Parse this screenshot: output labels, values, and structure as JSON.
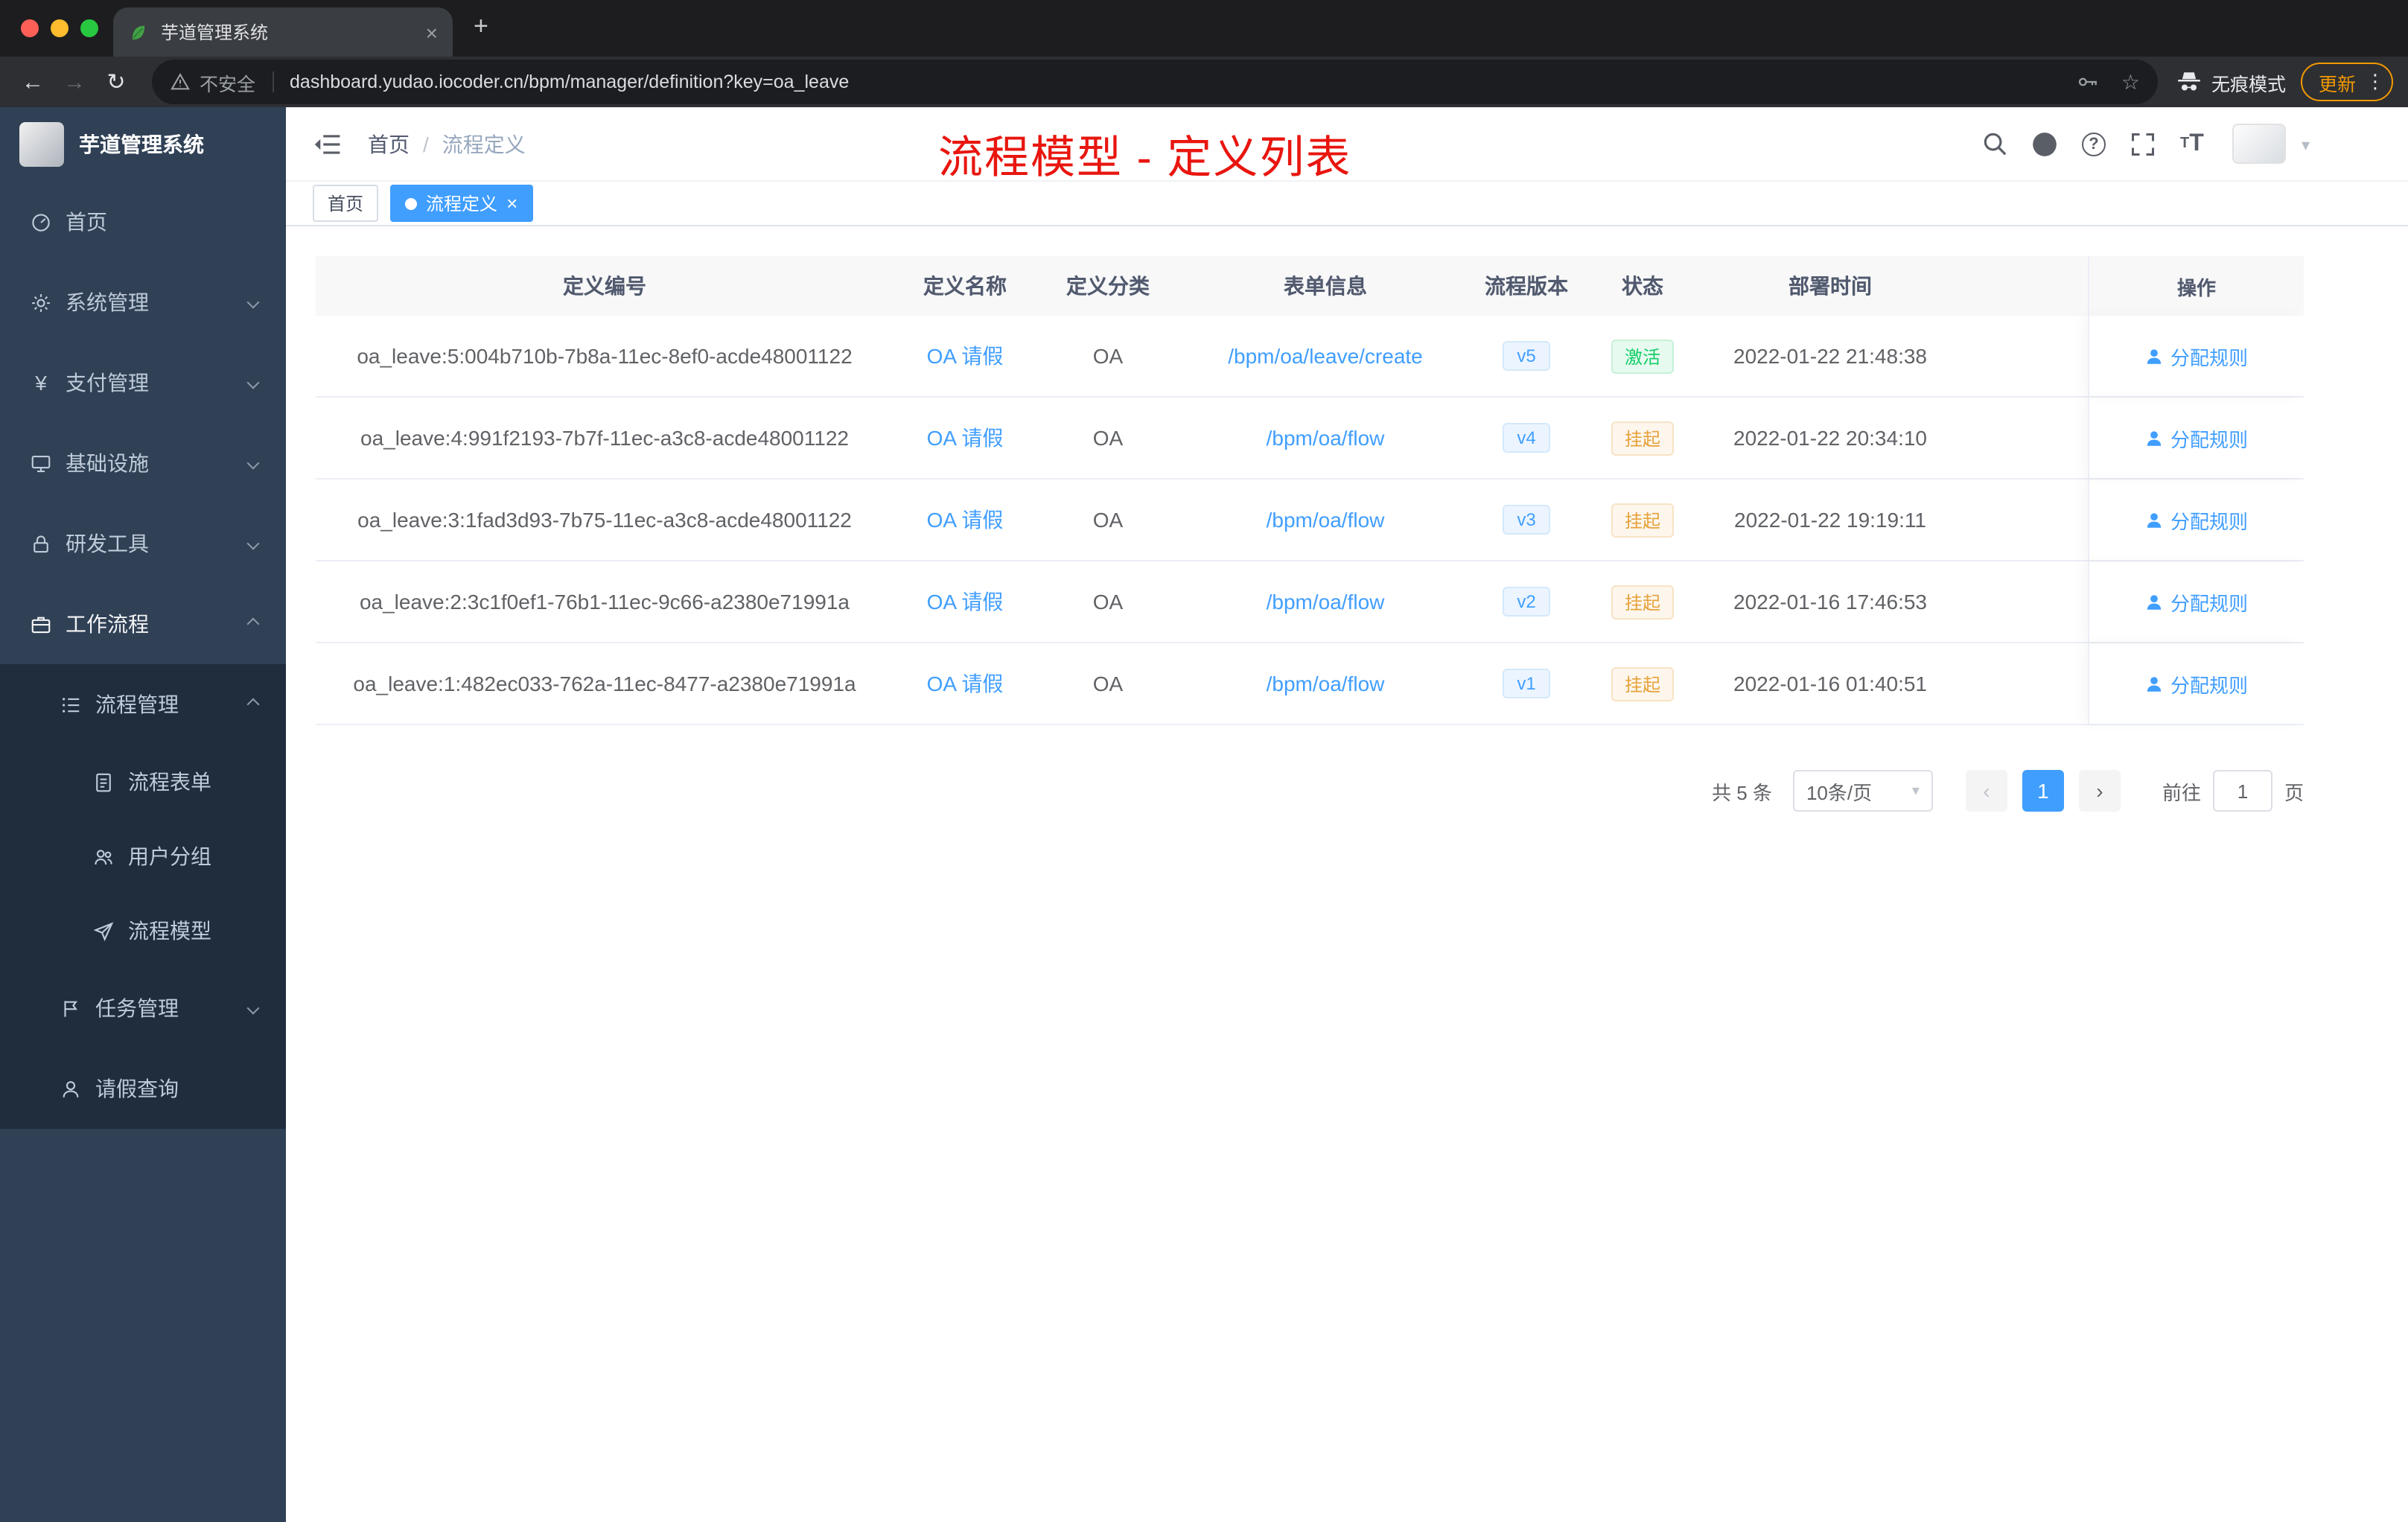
{
  "colors": {
    "accent": "#409eff",
    "success": "#13ce66",
    "warning": "#e6a23c",
    "annotation": "#e8160f",
    "sidebar": "#304156",
    "sidebarSub": "#1f2d3d"
  },
  "icons": {
    "back": "←",
    "forward": "→",
    "reload": "↻",
    "star": "☆",
    "kebab": "⋮",
    "plus": "+",
    "close": "×",
    "question": "?",
    "caret_down": "▾",
    "prev": "‹",
    "next": "›",
    "breadcrumb_sep": "/",
    "fontsize_big": "T",
    "fontsize_small": "T",
    "yen": "¥"
  },
  "browser": {
    "tab_title": "芋道管理系统",
    "security_label": "不安全",
    "url": "dashboard.yudao.iocoder.cn/bpm/manager/definition?key=oa_leave",
    "incognito_label": "无痕模式",
    "update_label": "更新"
  },
  "sidebar": {
    "title": "芋道管理系统",
    "items": [
      {
        "label": "首页",
        "icon": "dashboard-icon"
      },
      {
        "label": "系统管理",
        "icon": "gear-icon"
      },
      {
        "label": "支付管理",
        "icon": "yen-icon"
      },
      {
        "label": "基础设施",
        "icon": "infrastructure-icon"
      },
      {
        "label": "研发工具",
        "icon": "devtools-icon"
      },
      {
        "label": "工作流程",
        "icon": "workflow-icon"
      },
      {
        "label": "流程管理",
        "icon": "process-management-icon"
      },
      {
        "label": "流程表单",
        "icon": "form-icon"
      },
      {
        "label": "用户分组",
        "icon": "user-group-icon"
      },
      {
        "label": "流程模型",
        "icon": "paper-plane-icon"
      },
      {
        "label": "任务管理",
        "icon": "task-icon"
      },
      {
        "label": "请假查询",
        "icon": "user-icon"
      }
    ]
  },
  "header": {
    "breadcrumb_home": "首页",
    "breadcrumb_current": "流程定义",
    "annotation": "流程模型 - 定义列表"
  },
  "tags": {
    "home": "首页",
    "active": "流程定义"
  },
  "table": {
    "columns": [
      "定义编号",
      "定义名称",
      "定义分类",
      "表单信息",
      "流程版本",
      "状态",
      "部署时间",
      "操作"
    ],
    "rows": [
      {
        "id": "oa_leave:5:004b710b-7b8a-11ec-8ef0-acde48001122",
        "name": "OA 请假",
        "category": "OA",
        "form": "/bpm/oa/leave/create",
        "version": "v5",
        "status": "激活",
        "time": "2022-01-22 21:48:38",
        "action": "分配规则"
      },
      {
        "id": "oa_leave:4:991f2193-7b7f-11ec-a3c8-acde48001122",
        "name": "OA 请假",
        "category": "OA",
        "form": "/bpm/oa/flow",
        "version": "v4",
        "status": "挂起",
        "time": "2022-01-22 20:34:10",
        "action": "分配规则"
      },
      {
        "id": "oa_leave:3:1fad3d93-7b75-11ec-a3c8-acde48001122",
        "name": "OA 请假",
        "category": "OA",
        "form": "/bpm/oa/flow",
        "version": "v3",
        "status": "挂起",
        "time": "2022-01-22 19:19:11",
        "action": "分配规则"
      },
      {
        "id": "oa_leave:2:3c1f0ef1-76b1-11ec-9c66-a2380e71991a",
        "name": "OA 请假",
        "category": "OA",
        "form": "/bpm/oa/flow",
        "version": "v2",
        "status": "挂起",
        "time": "2022-01-16 17:46:53",
        "action": "分配规则"
      },
      {
        "id": "oa_leave:1:482ec033-762a-11ec-8477-a2380e71991a",
        "name": "OA 请假",
        "category": "OA",
        "form": "/bpm/oa/flow",
        "version": "v1",
        "status": "挂起",
        "time": "2022-01-16 01:40:51",
        "action": "分配规则"
      }
    ]
  },
  "pagination": {
    "total": "共 5 条",
    "page_size": "10条/页",
    "current": "1",
    "goto_label": "前往",
    "goto_value": "1",
    "unit_label": "页"
  }
}
